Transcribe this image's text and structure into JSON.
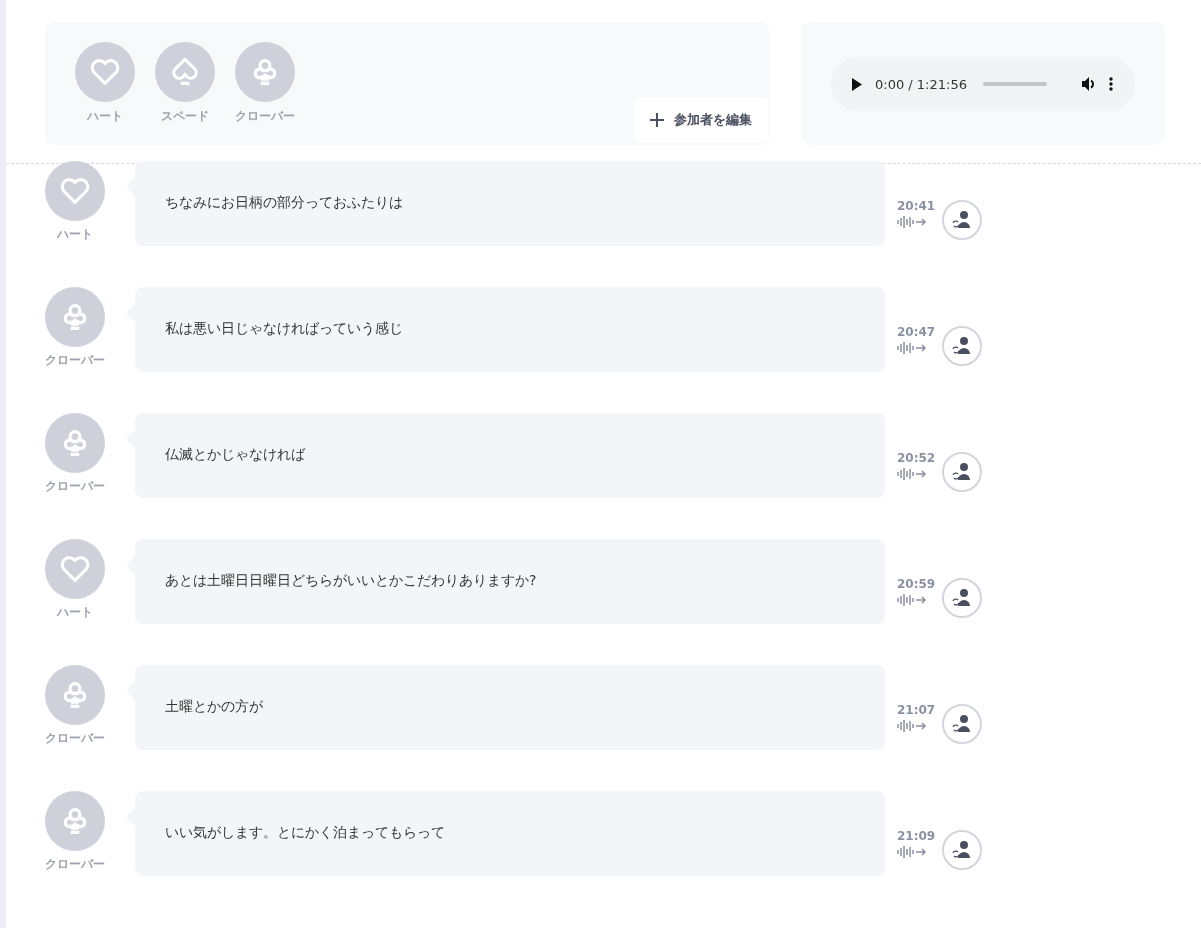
{
  "participants": [
    {
      "kind": "heart",
      "name": "ハート"
    },
    {
      "kind": "spade",
      "name": "スペード"
    },
    {
      "kind": "club",
      "name": "クローバー"
    }
  ],
  "edit_button": {
    "label": "参加者を編集"
  },
  "audio_player": {
    "time": "0:00 / 1:21:56"
  },
  "messages": [
    {
      "kind": "heart",
      "speaker": "ハート",
      "text": "ちなみにお日柄の部分っておふたりは",
      "time": "20:41"
    },
    {
      "kind": "club",
      "speaker": "クローバー",
      "text": "私は悪い日じゃなければっていう感じ",
      "time": "20:47"
    },
    {
      "kind": "club",
      "speaker": "クローバー",
      "text": "仏滅とかじゃなければ",
      "time": "20:52"
    },
    {
      "kind": "heart",
      "speaker": "ハート",
      "text": "あとは土曜日日曜日どちらがいいとかこだわりありますか?",
      "time": "20:59"
    },
    {
      "kind": "club",
      "speaker": "クローバー",
      "text": "土曜とかの方が",
      "time": "21:07"
    },
    {
      "kind": "club",
      "speaker": "クローバー",
      "text": "いい気がします。とにかく泊まってもらって",
      "time": "21:09"
    }
  ]
}
